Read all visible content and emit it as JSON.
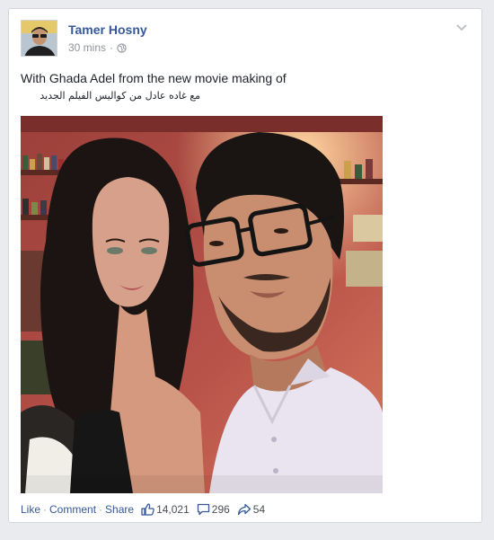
{
  "post": {
    "author": "Tamer Hosny",
    "timestamp": "30 mins",
    "audience_icon": "globe-icon",
    "text_en": "With Ghada Adel from the new movie making of",
    "text_ar": "مع غاده عادل من كواليس الفيلم الجديد"
  },
  "actions": {
    "like": "Like",
    "separator": "·",
    "comment": "Comment",
    "share": "Share"
  },
  "stats": {
    "likes": "14,021",
    "comments": "296",
    "shares": "54"
  },
  "colors": {
    "link": "#365899",
    "text": "#1d2129",
    "muted": "#90949c",
    "background": "#e9ebee"
  }
}
